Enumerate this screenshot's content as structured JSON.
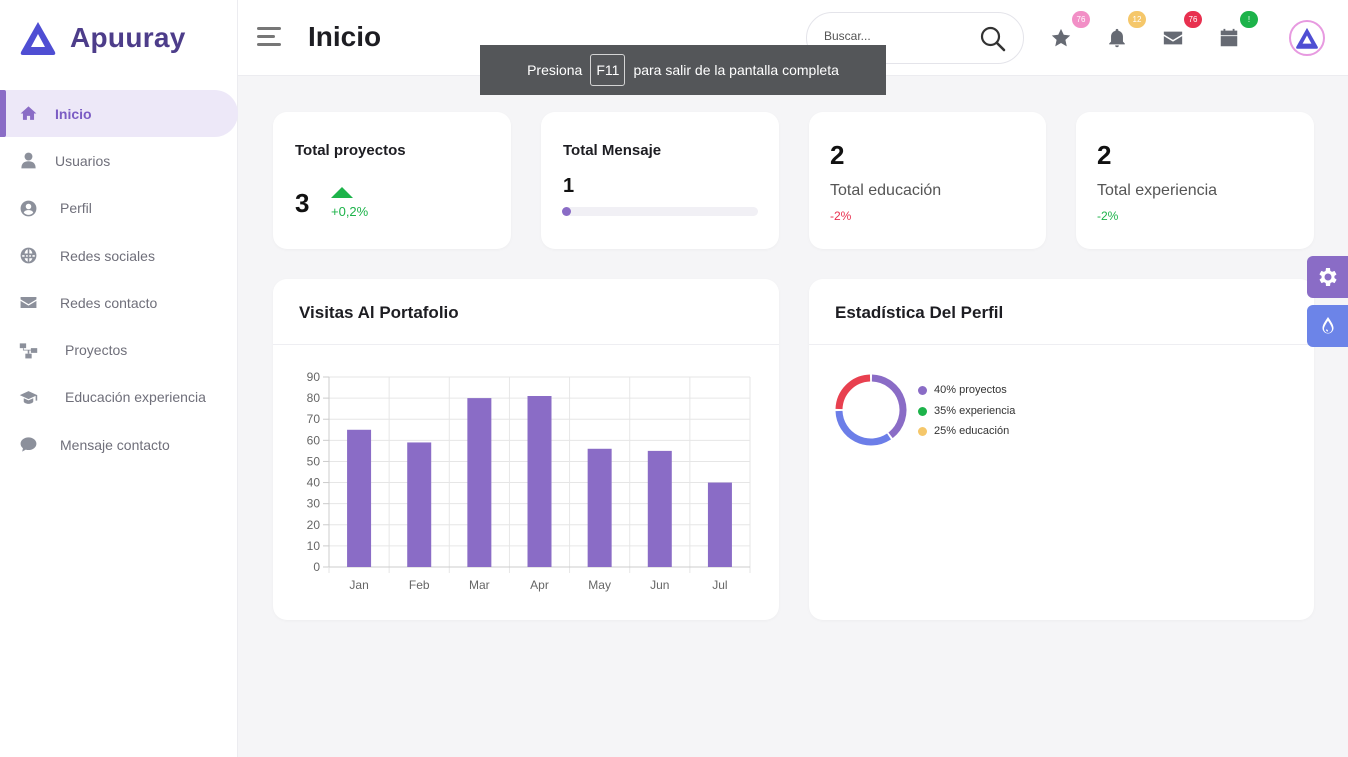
{
  "brand": {
    "name": "Apuuray",
    "accent": "#8a6cc6"
  },
  "sidebar": {
    "items": [
      {
        "label": "Inicio",
        "icon": "home-icon",
        "active": true
      },
      {
        "label": "Usuarios",
        "icon": "user-icon"
      },
      {
        "label": "Perfil",
        "icon": "user-circle-icon"
      },
      {
        "label": "Redes sociales",
        "icon": "globe-icon"
      },
      {
        "label": "Redes contacto",
        "icon": "envelope-icon"
      },
      {
        "label": "Proyectos",
        "icon": "sitemap-icon"
      },
      {
        "label": "Educación experiencia",
        "icon": "graduation-cap-icon"
      },
      {
        "label": "Mensaje contacto",
        "icon": "comment-icon"
      }
    ]
  },
  "header": {
    "title": "Inicio",
    "search_placeholder": "Buscar...",
    "icons": [
      {
        "name": "star-icon",
        "badge": "76",
        "badge_color": "#f28fc6"
      },
      {
        "name": "bell-icon",
        "badge": "12",
        "badge_color": "#f5c76a"
      },
      {
        "name": "mail-icon",
        "badge": "76",
        "badge_color": "#e8304f"
      },
      {
        "name": "calendar-icon",
        "badge": "!",
        "badge_color": "#1db34a"
      }
    ]
  },
  "toast": {
    "before": "Presiona",
    "key": "F11",
    "after": "para salir de la pantalla completa"
  },
  "stats": {
    "projects": {
      "title": "Total proyectos",
      "value": "3",
      "change": "+0,2%"
    },
    "messages": {
      "title": "Total Mensaje",
      "value": "1",
      "progress": 0.04
    },
    "education": {
      "value": "2",
      "label": "Total educación",
      "change": "-2%"
    },
    "experience": {
      "value": "2",
      "label": "Total experiencia",
      "change": "-2%"
    }
  },
  "visits": {
    "title": "Visitas Al Portafolio"
  },
  "profile_stats": {
    "title": "Estadística Del Perfil",
    "legend": [
      {
        "label": "40% proyectos",
        "color": "#8a6cc6"
      },
      {
        "label": "35% experiencia",
        "color": "#1db34a"
      },
      {
        "label": "25% educación",
        "color": "#f5c76a"
      }
    ]
  },
  "chart_data": [
    {
      "type": "bar",
      "categories": [
        "Jan",
        "Feb",
        "Mar",
        "Apr",
        "May",
        "Jun",
        "Jul"
      ],
      "values": [
        65,
        59,
        80,
        81,
        56,
        55,
        40
      ],
      "ylim": [
        0,
        90
      ],
      "yticks": [
        0,
        10,
        20,
        30,
        40,
        50,
        60,
        70,
        80,
        90
      ],
      "color": "#8a6cc6",
      "grid": true
    },
    {
      "type": "pie",
      "categories": [
        "proyectos",
        "experiencia",
        "educación"
      ],
      "values": [
        40,
        35,
        25
      ],
      "drawn_colors": [
        "#8a6cc6",
        "#6c7ee8",
        "#e8404f"
      ]
    }
  ]
}
